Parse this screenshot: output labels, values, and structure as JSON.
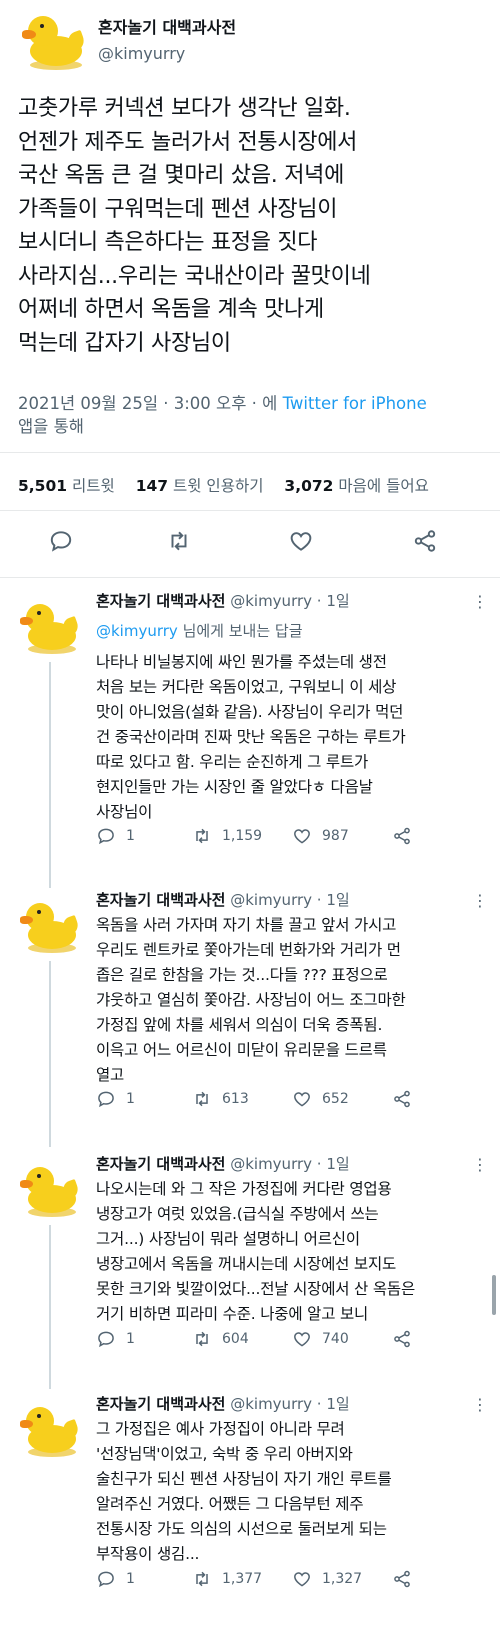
{
  "main_tweet": {
    "display_name": "혼자놀기 대백과사전",
    "handle": "@kimyurry",
    "text": "고춧가루 커넥션 보다가 생각난 일화.\n언젠가 제주도 놀러가서 전통시장에서\n국산 옥돔 큰 걸 몇마리 샀음. 저녁에\n가족들이 구워먹는데 펜션 사장님이\n보시더니 측은하다는 표정을 짓다\n사라지심...우리는 국내산이라 꿀맛이네\n어쩌네 하면서 옥돔을 계속 맛나게\n먹는데 갑자기 사장님이",
    "timestamp": "2021년 09월 25일 · 3:00 오후 · 에",
    "app_name": "Twitter for iPhone",
    "app_suffix": "앱을 통해",
    "retweets": "5,501",
    "retweets_label": "리트윗",
    "quotes": "147",
    "quotes_label": "트윗 인용하기",
    "likes": "3,072",
    "likes_label": "마음에 들어요"
  },
  "replies": [
    {
      "display_name": "혼자놀기 대백과사전",
      "meta": "@kimyurry · 1일",
      "replying_mention": "@kimyurry",
      "replying_suffix": "님에게 보내는 답글",
      "text": "나타나 비닐봉지에 싸인 뭔가를 주셨는데 생전\n처음 보는 커다란 옥돔이었고, 구워보니 이 세상\n맛이 아니었음(설화 같음). 사장님이 우리가 먹던\n건 중국산이라며 진짜 맛난 옥돔은 구하는 루트가\n따로 있다고 함. 우리는 순진하게 그 루트가\n현지인들만 가는 시장인 줄 알았다ㅎ 다음날\n사장님이",
      "reply_count": "1",
      "retweet_count": "1,159",
      "like_count": "987"
    },
    {
      "display_name": "혼자놀기 대백과사전",
      "meta": "@kimyurry · 1일",
      "text": "옥돔을 사러 가자며 자기 차를 끌고 앞서 가시고\n우리도 렌트카로 쫓아가는데 번화가와 거리가 먼\n좁은 길로 한참을 가는 것...다들 ??? 표정으로\n갸웃하고 열심히 쫓아감. 사장님이 어느 조그마한\n가정집 앞에 차를 세워서 의심이 더욱 증폭됨.\n이윽고 어느 어르신이 미닫이 유리문을 드르륵\n열고",
      "reply_count": "1",
      "retweet_count": "613",
      "like_count": "652"
    },
    {
      "display_name": "혼자놀기 대백과사전",
      "meta": "@kimyurry · 1일",
      "text": "나오시는데 와 그 작은 가정집에 커다란 영업용\n냉장고가 여럿 있었음.(급식실 주방에서 쓰는\n그거...) 사장님이 뭐라 설명하니 어르신이\n냉장고에서 옥돔을 꺼내시는데 시장에선 보지도\n못한 크기와 빛깔이었다...전날 시장에서 산 옥돔은\n거기 비하면 피라미 수준. 나중에 알고 보니",
      "reply_count": "1",
      "retweet_count": "604",
      "like_count": "740"
    },
    {
      "display_name": "혼자놀기 대백과사전",
      "meta": "@kimyurry · 1일",
      "text": "그 가정집은 예사 가정집이 아니라 무려\n'선장님댁'이었고, 숙박 중 우리 아버지와\n술친구가 되신 펜션 사장님이 자기 개인 루트를\n알려주신 거였다. 어쨌든 그 다음부턴 제주\n전통시장 가도 의심의 시선으로 둘러보게 되는\n부작용이 생김...",
      "reply_count": "1",
      "retweet_count": "1,377",
      "like_count": "1,327"
    }
  ],
  "colors": {
    "text": "#0f1419",
    "secondary": "#536471",
    "link": "#1d9bf0",
    "duck_body": "#f7cf1d",
    "duck_beak": "#f08a16"
  },
  "icons": {
    "reply": "reply-icon",
    "retweet": "retweet-icon",
    "like": "heart-icon",
    "share": "share-icon",
    "more": "more-icon",
    "avatar": "duck-avatar"
  }
}
